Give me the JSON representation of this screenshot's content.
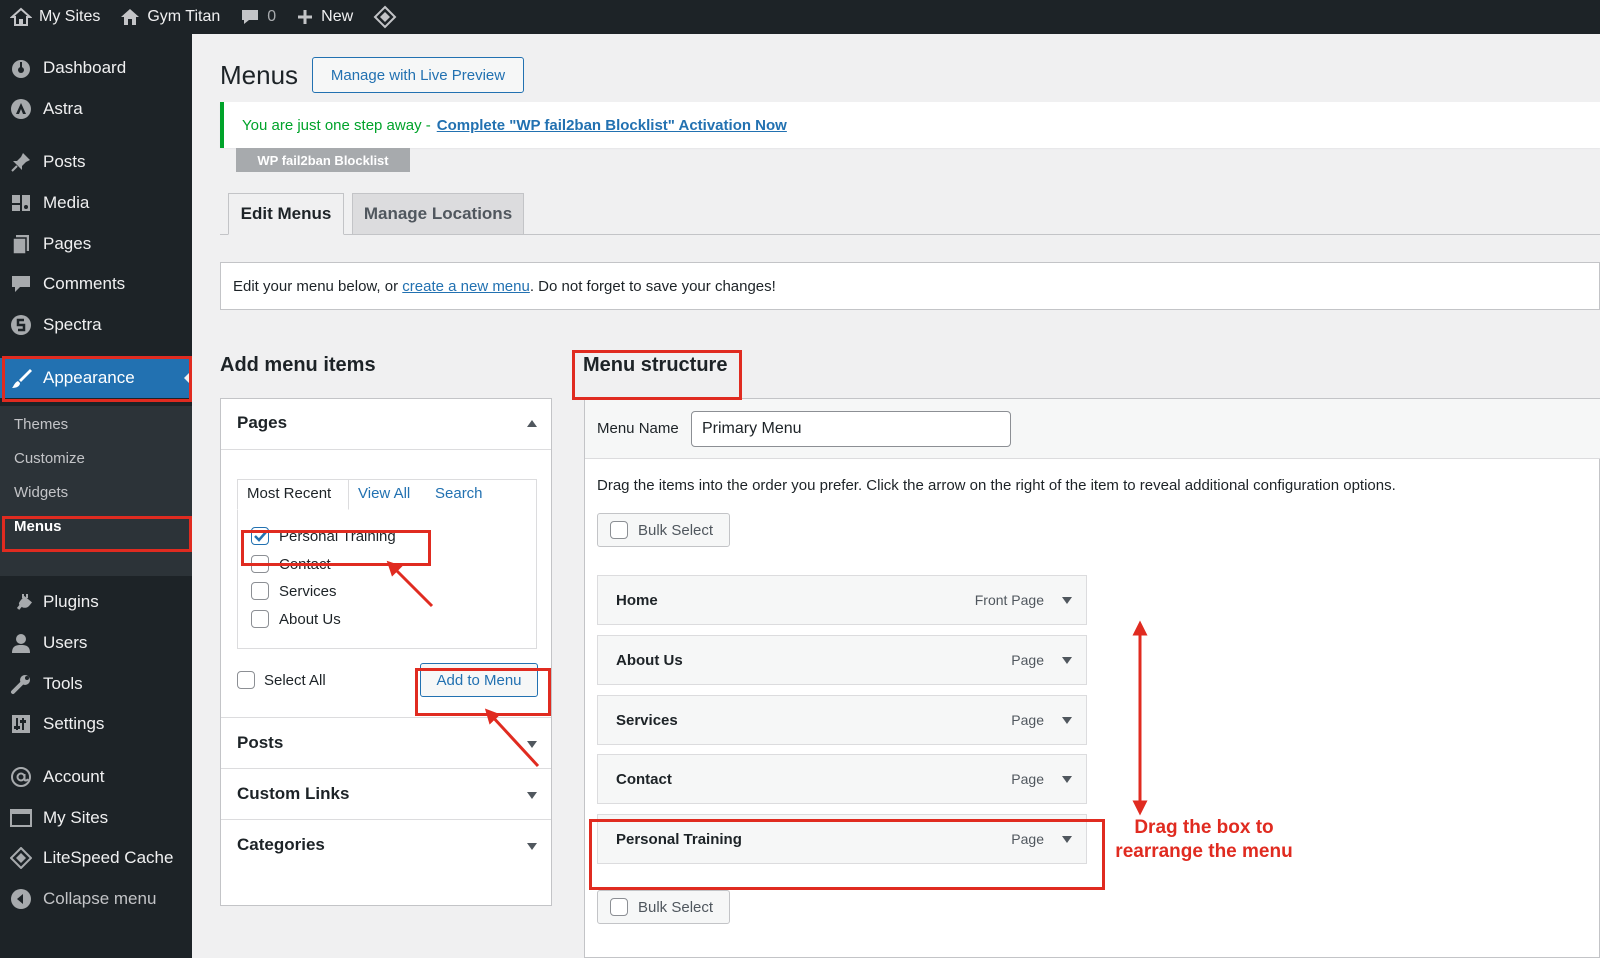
{
  "adminbar": {
    "my_sites": "My Sites",
    "site_name": "Gym Titan",
    "comments_count": "0",
    "new_label": "New"
  },
  "sidebar": {
    "items": [
      {
        "label": "Dashboard",
        "icon": "dashboard-icon"
      },
      {
        "label": "Astra",
        "icon": "astra-icon"
      },
      {
        "label": "Posts",
        "icon": "pin-icon"
      },
      {
        "label": "Media",
        "icon": "media-icon"
      },
      {
        "label": "Pages",
        "icon": "pages-icon"
      },
      {
        "label": "Comments",
        "icon": "comment-icon"
      },
      {
        "label": "Spectra",
        "icon": "spectra-icon"
      },
      {
        "label": "Appearance",
        "icon": "brush-icon"
      },
      {
        "label": "Plugins",
        "icon": "plug-icon"
      },
      {
        "label": "Users",
        "icon": "user-icon"
      },
      {
        "label": "Tools",
        "icon": "wrench-icon"
      },
      {
        "label": "Settings",
        "icon": "settings-icon"
      },
      {
        "label": "Account",
        "icon": "at-icon"
      },
      {
        "label": "My Sites",
        "icon": "sites-icon"
      },
      {
        "label": "LiteSpeed Cache",
        "icon": "diamond-icon"
      },
      {
        "label": "Collapse menu",
        "icon": "collapse-icon"
      }
    ],
    "submenu": [
      "Themes",
      "Customize",
      "Widgets",
      "Menus"
    ]
  },
  "page": {
    "title": "Menus",
    "live_preview": "Manage with Live Preview",
    "notice_text": "You are just one step away -",
    "notice_link": "Complete \"WP fail2ban Blocklist\" Activation Now",
    "badge": "WP fail2ban Blocklist",
    "tabs": [
      "Edit Menus",
      "Manage Locations"
    ],
    "info_before": "Edit your menu below, or",
    "info_link": "create a new menu",
    "info_after": ". Do not forget to save your changes!"
  },
  "add_items": {
    "heading": "Add menu items",
    "pages_title": "Pages",
    "subtabs": [
      "Most Recent",
      "View All",
      "Search"
    ],
    "pages": [
      {
        "label": "Personal Training",
        "checked": true
      },
      {
        "label": "Contact",
        "checked": false
      },
      {
        "label": "Services",
        "checked": false
      },
      {
        "label": "About Us",
        "checked": false
      }
    ],
    "select_all": "Select All",
    "add_button": "Add to Menu",
    "sections": [
      "Posts",
      "Custom Links",
      "Categories"
    ]
  },
  "structure": {
    "heading": "Menu structure",
    "name_label": "Menu Name",
    "name_value": "Primary Menu",
    "instructions": "Drag the items into the order you prefer. Click the arrow on the right of the item to reveal additional configuration options.",
    "bulk_select": "Bulk Select",
    "items": [
      {
        "title": "Home",
        "type": "Front Page"
      },
      {
        "title": "About Us",
        "type": "Page"
      },
      {
        "title": "Services",
        "type": "Page"
      },
      {
        "title": "Contact",
        "type": "Page"
      },
      {
        "title": "Personal Training",
        "type": "Page"
      }
    ],
    "annotation_line1": "Drag the box to",
    "annotation_line2": "rearrange the menu"
  },
  "colors": {
    "admin_dark": "#1d2327",
    "accent": "#2271b1",
    "highlight": "#e02b20",
    "success": "#00a32a"
  }
}
